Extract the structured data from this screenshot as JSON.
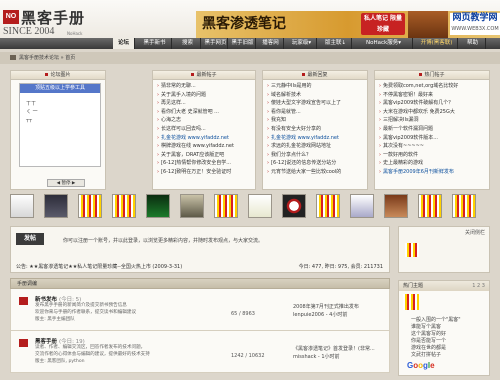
{
  "header": {
    "logo_badge": "NO",
    "logo_title": "黑客手册",
    "logo_since": "SINCE 2004",
    "logo_tagline": "NoHack",
    "banner_title": "黑客渗透笔记",
    "banner_badge": "私人笔记 限量珍藏",
    "site_logo": "网页教学网",
    "site_logo_url": "WWW.WEB3X.COM"
  },
  "nav": {
    "items": [
      {
        "label": "论坛"
      },
      {
        "label": "黑手新书"
      },
      {
        "label": "搜索"
      },
      {
        "label": "黑手网页"
      },
      {
        "label": "黑手旧版"
      },
      {
        "label": "播客网"
      },
      {
        "label": "玩家级▾"
      },
      {
        "label": "版主联↓"
      },
      {
        "label": "NoHack服务▾"
      },
      {
        "label": "开博(黑客联)"
      },
      {
        "label": "帮助"
      }
    ]
  },
  "breadcrumb": {
    "text": "黑客手册技术论坛 » 首页"
  },
  "panels": {
    "photo": {
      "title": "论坛图片",
      "caption": "顶贴五级以上学参工具",
      "lines": [
        "ㄒㄒ",
        "ㄑ 一",
        "┬┬"
      ],
      "control": "◀ 暂停 ▶"
    },
    "new_posts": {
      "title": "最新帖子",
      "items": [
        "猜非常的无聊...",
        "关于黑手入境的问题",
        "再见这样...",
        "看你们大老 史深就管吧 ...",
        "心海之志",
        "长这样可以回去吗...",
        "扎金花游戏 www.yifaddz.net",
        "棋牌游戏在线 www.yifaddz.net",
        "关于黑客，DRAT应该版正吧",
        "[6-12]热情帮你修改安全自学...",
        "[6-12]致明在万正！安全验证时"
      ]
    },
    "new_replies": {
      "title": "最新回复",
      "items": [
        "三元静中IIs是用的",
        "域名解析技术",
        "傻娃大型文字游戏宣告可以上了",
        "看你是就管...",
        "我充知",
        "有没有安全大好分享的",
        "扎金花游戏 www.yifaddz.net",
        "求远的扎金花游戏网站地址",
        "我们分享点什么？",
        "[6-12]说还的信息传送分站分",
        "元宵节送给大家一些比较cool的"
      ]
    },
    "hot_posts": {
      "title": "热门帖子",
      "items": [
        "免费领取com,net,org域名比较好",
        "不停黑客密钥！最好来",
        "黑客vip2009软件破解有几个？",
        "大米在游戏中都欢乐 免费25G大",
        "三招解决IIs漏洞",
        "最新一个软件漏洞问题",
        "黑客vip2009软件版本...",
        "其次没有~~~~~",
        "一款好用的软件",
        "史上最精彩的游戏",
        "黑客手册2009年6月刊新鲜发布"
      ]
    }
  },
  "intro": {
    "badge": "发帖",
    "text": "你可以注册一个账号，并以此登录，以浏览更多精彩内容，并随时发布观点，与大家交流。",
    "notice": "公告: ★★黑客渗透笔记★★私人笔记限量珍藏--全国火热上市 (2009-3-31)",
    "stats": "今日: 477, 昨日: 975, 会员: 211731"
  },
  "sidebar": {
    "close": "关闭侧栏",
    "hot_title": "热门主题",
    "hot_tabs": "1 2 3",
    "hot_text": [
      "一般入围的一个\"黑客\"",
      "谁能写个黑客",
      "这个黑客写的好",
      "你是否能写一个",
      "游戏在世的都是",
      "文武打拼帖子"
    ],
    "google": "Google"
  },
  "forums": {
    "head": "手册调编",
    "rows": [
      {
        "name": "新书发布",
        "today": "(今日: 5)",
        "desc": [
          "发布黑手手册的新闻简介及提交新书预告信息",
          "欢迎你来与手册的作者联系，提交读书和编辑建议",
          "版主: 黑手主编团队"
        ],
        "count": "65 / 8963",
        "last": [
          "2008年第7月刊正式推出发布",
          "lenpuie2006 - 4小时前"
        ]
      },
      {
        "name": "黑客手册",
        "today": "(今日: 19)",
        "desc": [
          "读者、作者、编辑交流区，回答作者发布的技术问题，",
          "交流作者的心得体会与编辑的建议，提供最好的技术支持",
          "版主: 黑客团队, python"
        ],
        "count": "1242 / 10632",
        "last": [
          "《黑客渗透笔记》首发登录！(非常...",
          "misshack - 1小时前"
        ]
      }
    ]
  },
  "colors": {
    "accent_red": "#b41d1d",
    "nav_dark": "#3a3a3a",
    "photo_caption_blue": "#5577c9",
    "link_blue": "#0b4e9c"
  },
  "icons": {
    "home": "home-icon",
    "forum": "forum-folder-icon",
    "list_bullet": "arrow-bullet-icon"
  }
}
